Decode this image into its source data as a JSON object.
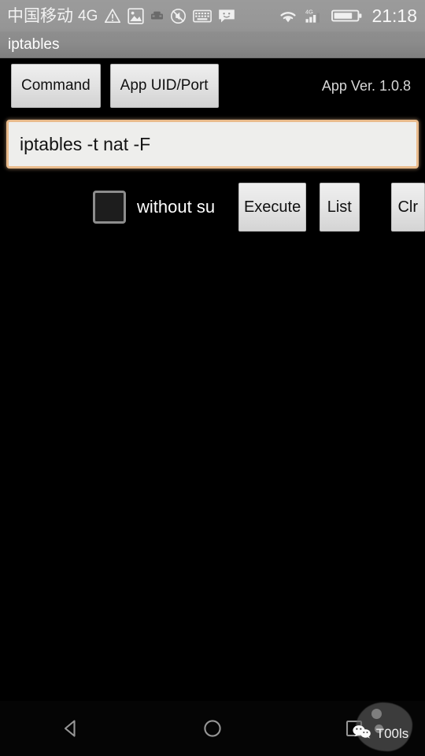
{
  "status_bar": {
    "carrier": "中国移动",
    "network_type": "4G",
    "clock": "21:18",
    "left_icons": [
      "warning-triangle-icon",
      "image-icon",
      "vpn-icon",
      "silent-mode-icon",
      "keyboard-icon",
      "message-icon"
    ],
    "right_icons": [
      "wifi-icon",
      "mobile-signal-4g-icon",
      "battery-icon"
    ],
    "signal_label": "4G"
  },
  "title_bar": {
    "app_title": "iptables"
  },
  "tabs": {
    "command_label": "Command",
    "app_uid_port_label": "App UID/Port",
    "app_version": "App Ver. 1.0.8"
  },
  "command_field": {
    "value": "iptables -t nat -F",
    "placeholder": "iptables -t nat -F"
  },
  "controls": {
    "without_su_label": "without su",
    "without_su_checked": false,
    "execute_label": "Execute",
    "list_label": "List",
    "clear_label": "Clr"
  },
  "output": {
    "text": ""
  },
  "nav_bar": {
    "back_label": "back-icon",
    "home_label": "home-icon",
    "recents_label": "recents-icon"
  },
  "watermark": {
    "text": "T00ls",
    "logo": "wechat-icon"
  },
  "colors": {
    "status_bar_bg": "#989898",
    "title_bar_bg": "#8b8b8b",
    "page_bg": "#000000",
    "input_focus_border": "#e9bb8c",
    "input_bg": "#eeeeec",
    "button_bg": "#e4e4e4",
    "text_light": "#ffffff"
  }
}
